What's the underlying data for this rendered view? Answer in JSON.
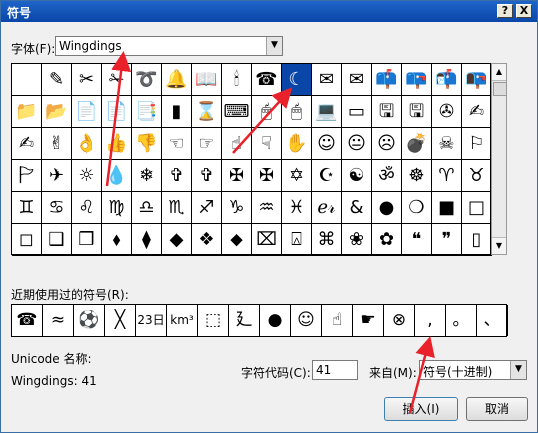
{
  "title": "符号",
  "title_buttons": {
    "help": "?",
    "close": "X"
  },
  "font_label": "字体(F):",
  "font_value": "Wingdings",
  "symbols": [
    [
      "",
      "✎",
      "✂",
      "✁",
      "➰",
      "🔔",
      "📖",
      "🕯",
      "☎",
      "☾",
      "✉",
      "✉",
      "📫",
      "📪",
      "📬",
      "📭"
    ],
    [
      "📁",
      "📂",
      "📄",
      "📄",
      "📑",
      "▮",
      "⌛",
      "⌨",
      "🖱",
      "🖱",
      "💻",
      "▭",
      "🖫",
      "🖫",
      "✇",
      "✍"
    ],
    [
      "✍",
      "✌",
      "👌",
      "👍",
      "👎",
      "☜",
      "☞",
      "☝",
      "☟",
      "✋",
      "☺",
      "😐",
      "☹",
      "💣",
      "☠",
      "⚐"
    ],
    [
      "🏱",
      "✈",
      "☼",
      "💧",
      "❄",
      "✞",
      "✞",
      "✠",
      "✠",
      "✡",
      "☪",
      "☯",
      "ॐ",
      "☸",
      "♈",
      "♉"
    ],
    [
      "♊",
      "♋",
      "♌",
      "♍",
      "♎",
      "♏",
      "♐",
      "♑",
      "♒",
      "♓",
      "ℯ𝓇",
      "&",
      "●",
      "❍",
      "■",
      "□"
    ],
    [
      "◻",
      "❑",
      "❒",
      "⬧",
      "⧫",
      "◆",
      "❖",
      "⬥",
      "⌧",
      "⍓",
      "⌘",
      "❀",
      "✿",
      "❝",
      "❞",
      "▯"
    ]
  ],
  "selected_symbol": "☾",
  "recent_label": "近期使用过的符号(R):",
  "recent_symbols": [
    "☎",
    "≈",
    "⚽",
    "╳",
    "23日",
    "km³",
    "⬚",
    "廴",
    "●",
    "☺",
    "☝",
    "☛",
    "⊗",
    ",",
    "。",
    "、"
  ],
  "unicode_label": "Unicode 名称:",
  "unicode_value": "Wingdings: 41",
  "charcode_label": "字符代码(C):",
  "charcode_value": "41",
  "from_label": "来自(M):",
  "from_value": "符号(十进制)",
  "insert_button": "插入(I)",
  "cancel_button": "取消",
  "colors": {
    "arrow": "#e8212a",
    "selection": "#0a46a8",
    "titlebar": "#1f64c8"
  }
}
